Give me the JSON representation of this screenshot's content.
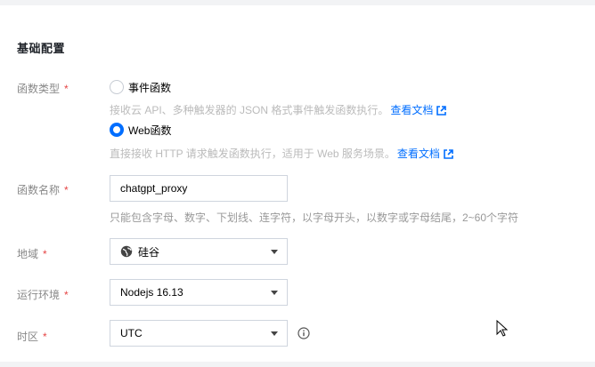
{
  "section": {
    "title": "基础配置"
  },
  "function_type": {
    "label": "函数类型",
    "required_mark": "*",
    "options": [
      {
        "label": "事件函数",
        "checked": false,
        "help": "接收云 API、多种触发器的 JSON 格式事件触发函数执行。",
        "link": "查看文档"
      },
      {
        "label": "Web函数",
        "checked": true,
        "help": "直接接收 HTTP 请求触发函数执行，适用于 Web 服务场景。",
        "link": "查看文档"
      }
    ]
  },
  "function_name": {
    "label": "函数名称",
    "required_mark": "*",
    "value": "chatgpt_proxy",
    "help": "只能包含字母、数字、下划线、连字符，以字母开头，以数字或字母结尾，2~60个字符"
  },
  "region": {
    "label": "地域",
    "required_mark": "*",
    "value": "硅谷",
    "icon": "globe-icon"
  },
  "runtime": {
    "label": "运行环境",
    "required_mark": "*",
    "value": "Nodejs 16.13"
  },
  "timezone": {
    "label": "时区",
    "required_mark": "*",
    "value": "UTC",
    "icon": "info-icon"
  },
  "colors": {
    "accent": "#006eff",
    "required": "#e54545",
    "label": "#888888",
    "help": "#bbbbbb"
  }
}
